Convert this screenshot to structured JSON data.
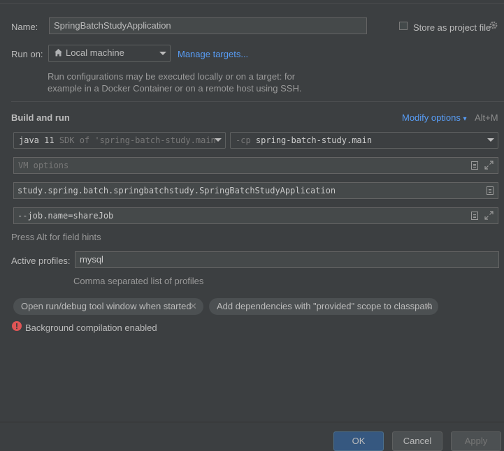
{
  "name": {
    "label": "Name:",
    "value": "SpringBatchStudyApplication"
  },
  "store_project_file": {
    "label": "Store as project file"
  },
  "run_on": {
    "label": "Run on:",
    "target": "Local machine",
    "manage_targets": "Manage targets...",
    "description_line1": "Run configurations may be executed locally or on a target: for",
    "description_line2": "example in a Docker Container or on a remote host using SSH."
  },
  "build_run": {
    "title": "Build and run",
    "modify_options": "Modify options",
    "shortcut": "Alt+M",
    "jdk_version": "java 11",
    "jdk_detail": "SDK of 'spring-batch-study.main",
    "cp_prefix": "-cp",
    "cp_module": "spring-batch-study.main",
    "vm_options_placeholder": "VM options",
    "main_class": "study.spring.batch.springbatchstudy.SpringBatchStudyApplication",
    "program_args": "--job.name=shareJob",
    "field_hint": "Press Alt for field hints"
  },
  "profiles": {
    "label": "Active profiles:",
    "value": "mysql",
    "hint": "Comma separated list of profiles"
  },
  "chips": [
    {
      "label": "Open run/debug tool window when started",
      "close": "✕"
    },
    {
      "label": "Add dependencies with \"provided\" scope to classpath",
      "close": "✕"
    }
  ],
  "background_compilation": "Background compilation enabled",
  "buttons": {
    "ok": "OK",
    "cancel": "Cancel",
    "apply": "Apply"
  },
  "colors": {
    "background": "#3c3f41",
    "link": "#589df6",
    "error": "#e05555",
    "primary_button": "#365880"
  }
}
